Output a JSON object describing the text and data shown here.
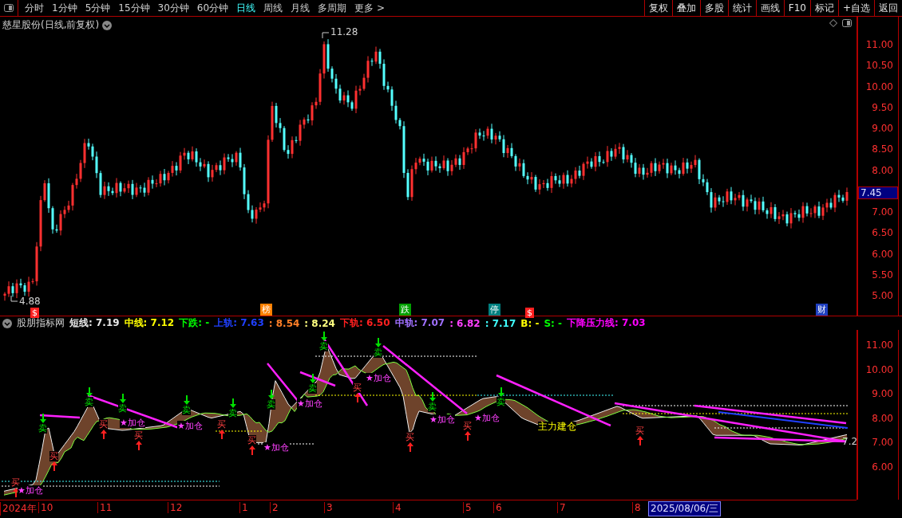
{
  "toolbar": {
    "periods": [
      {
        "label": "分时",
        "selected": false
      },
      {
        "label": "1分钟",
        "selected": false
      },
      {
        "label": "5分钟",
        "selected": false
      },
      {
        "label": "15分钟",
        "selected": false
      },
      {
        "label": "30分钟",
        "selected": false
      },
      {
        "label": "60分钟",
        "selected": false
      },
      {
        "label": "日线",
        "selected": true
      },
      {
        "label": "周线",
        "selected": false
      },
      {
        "label": "月线",
        "selected": false
      },
      {
        "label": "多周期",
        "selected": false
      },
      {
        "label": "更多 >",
        "selected": false
      }
    ],
    "actions": [
      "复权",
      "叠加",
      "多股",
      "统计",
      "画线",
      "F10",
      "标记",
      "+自选",
      "返回"
    ]
  },
  "main_chart": {
    "title": "慈星股份(日线,前复权)",
    "high_label": "11.28",
    "low_label": "4.88",
    "y_ticks": [
      "11.00",
      "10.50",
      "10.00",
      "9.50",
      "9.00",
      "8.50",
      "8.00",
      "7.00",
      "6.50",
      "6.00",
      "5.50",
      "5.00"
    ],
    "current_price": "7.45",
    "event_marks": [
      {
        "text": "$",
        "color": "#ff2020"
      },
      {
        "text": "榜",
        "color": "#ff8000"
      },
      {
        "text": "跌",
        "color": "#00a000"
      },
      {
        "text": "停",
        "color": "#008080"
      },
      {
        "text": "$",
        "color": "#ff2020"
      },
      {
        "text": "财",
        "color": "#2040c0"
      }
    ]
  },
  "indicator": {
    "name": "股朋指标网",
    "values": [
      {
        "text": "短线: 7.19",
        "color": "#e8e8e8"
      },
      {
        "text": "中线: 7.12",
        "color": "#ffff00"
      },
      {
        "text": "下跌: -",
        "color": "#00ff00"
      },
      {
        "text": "上轨: 7.63",
        "color": "#2040ff"
      },
      {
        "text": ": 8.54",
        "color": "#ff7f27"
      },
      {
        "text": ": 8.24",
        "color": "#ffff80"
      },
      {
        "text": "下轨: 6.50",
        "color": "#ff2020"
      },
      {
        "text": "中轨: 7.07",
        "color": "#a070ff"
      },
      {
        "text": ": 6.82",
        "color": "#ff40ff"
      },
      {
        "text": ": 7.17",
        "color": "#40ffff"
      },
      {
        "text": "B: -",
        "color": "#ffff00"
      },
      {
        "text": "S: -",
        "color": "#00ff00"
      },
      {
        "text": "下降压力线: 7.03",
        "color": "#ff00ff"
      }
    ],
    "y_ticks": [
      "11.00",
      "10.00",
      "9.00",
      "8.00",
      "7.00",
      "6.00"
    ],
    "end_label": "7.2",
    "signals": [
      {
        "kind": "sell",
        "text": "卖"
      },
      {
        "kind": "sell",
        "text": "卖"
      },
      {
        "kind": "sell",
        "text": "卖"
      },
      {
        "kind": "sell",
        "text": "卖"
      },
      {
        "kind": "sell",
        "text": "卖"
      },
      {
        "kind": "sell",
        "text": "卖"
      },
      {
        "kind": "sell",
        "text": "卖"
      },
      {
        "kind": "sell",
        "text": "卖"
      },
      {
        "kind": "sell",
        "text": "卖"
      },
      {
        "kind": "sell",
        "text": "卖"
      },
      {
        "kind": "sell",
        "text": "卖"
      },
      {
        "kind": "buy",
        "text": "买"
      },
      {
        "kind": "buy",
        "text": "买"
      },
      {
        "kind": "buy",
        "text": "买"
      },
      {
        "kind": "buy",
        "text": "买"
      },
      {
        "kind": "buy",
        "text": "买"
      },
      {
        "kind": "buy",
        "text": "买"
      },
      {
        "kind": "buy",
        "text": "买"
      },
      {
        "kind": "buy",
        "text": "买"
      },
      {
        "kind": "buy",
        "text": "买"
      },
      {
        "kind": "buy",
        "text": "买"
      },
      {
        "kind": "add",
        "text": "★加仓"
      },
      {
        "kind": "add",
        "text": "★加仓"
      },
      {
        "kind": "add",
        "text": "★加仓"
      },
      {
        "kind": "add",
        "text": "★加仓"
      },
      {
        "kind": "add",
        "text": "★加仓"
      },
      {
        "kind": "add",
        "text": "★加仓"
      },
      {
        "kind": "add",
        "text": "★加仓"
      },
      {
        "kind": "add",
        "text": "★加仓"
      },
      {
        "kind": "build",
        "text": "主力建仓"
      }
    ]
  },
  "date_axis": {
    "labels": [
      "2024年",
      "10",
      "11",
      "12",
      "1",
      "2",
      "3",
      "4",
      "5",
      "6",
      "7",
      "8"
    ],
    "cursor_date": "2025/08/06/三"
  }
}
